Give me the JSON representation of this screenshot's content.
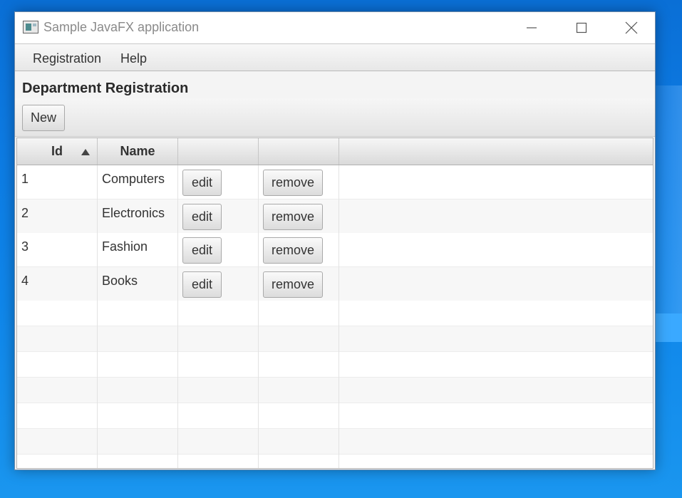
{
  "window": {
    "title": "Sample JavaFX application",
    "controls": {
      "minimize_icon": "minimize-icon",
      "maximize_icon": "maximize-icon",
      "close_icon": "close-icon"
    }
  },
  "menu": {
    "items": [
      "Registration",
      "Help"
    ]
  },
  "heading": "Department Registration",
  "toolbar": {
    "new_label": "New"
  },
  "table": {
    "columns": [
      "Id",
      "Name",
      "",
      ""
    ],
    "sorted_column": "Id",
    "sort_direction": "ascending",
    "rows": [
      {
        "id": "1",
        "name": "Computers",
        "edit": "edit",
        "remove": "remove"
      },
      {
        "id": "2",
        "name": "Electronics",
        "edit": "edit",
        "remove": "remove"
      },
      {
        "id": "3",
        "name": "Fashion",
        "edit": "edit",
        "remove": "remove"
      },
      {
        "id": "4",
        "name": "Books",
        "edit": "edit",
        "remove": "remove"
      }
    ],
    "empty_rows": 7
  },
  "colors": {
    "desktop": "#0d7be3",
    "window_bg": "#f4f4f4",
    "title_text": "#8a8a8a"
  }
}
